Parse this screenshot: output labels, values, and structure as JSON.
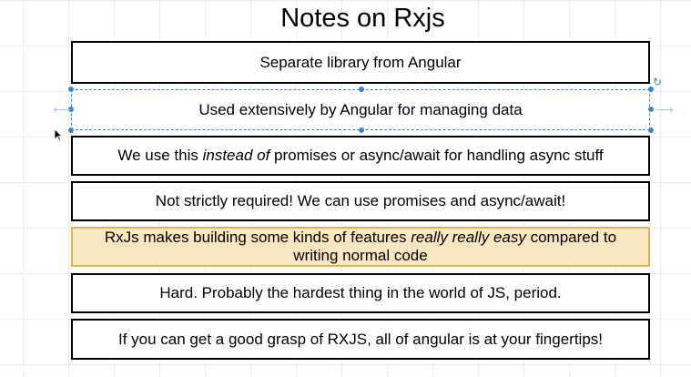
{
  "title": "Notes on Rxjs",
  "notes": [
    {
      "text": "Separate library from Angular"
    },
    {
      "text": "Used extensively by Angular for managing data"
    },
    {
      "before": "We use this ",
      "emphasis": "instead of",
      "after": " promises or async/await for handling async stuff"
    },
    {
      "text": "Not strictly required!  We can use promises and async/await!"
    },
    {
      "before": "RxJs makes building some kinds of features ",
      "emphasis": "really really easy",
      "after": " compared to writing normal code"
    },
    {
      "text": "Hard.  Probably the hardest thing in the world of JS, period."
    },
    {
      "text": "If you can get a good grasp of RXJS, all of angular is at your fingertips!"
    }
  ],
  "colors": {
    "highlight_fill": "#fbe6c2",
    "highlight_border": "#d6b656",
    "selection": "#3d87c9"
  },
  "icons": [
    "rotate-icon",
    "mouse-cursor-icon",
    "arrow-left-icon",
    "arrow-right-icon"
  ]
}
